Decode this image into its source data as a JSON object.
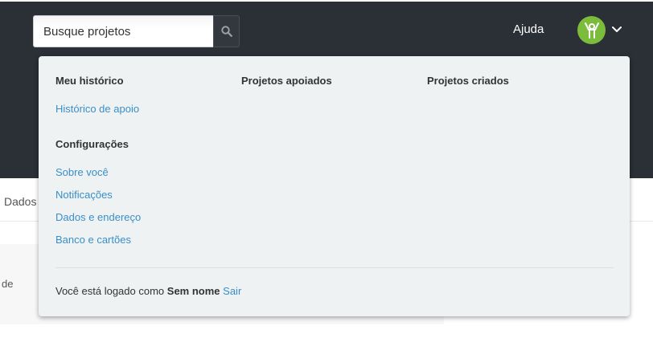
{
  "header": {
    "search": {
      "placeholder": "Busque projetos",
      "value": ""
    },
    "help_label": "Ajuda"
  },
  "dropdown": {
    "columns": [
      "Meu histórico",
      "Projetos apoiados",
      "Projetos criados"
    ],
    "history_links": [
      "Histórico de apoio"
    ],
    "settings_title": "Configurações",
    "settings_links": [
      "Sobre você",
      "Notificações",
      "Dados e endereço",
      "Banco e cartões"
    ],
    "footer": {
      "prefix": "Você está logado como",
      "user_name": "Sem nome",
      "logout_label": "Sair"
    }
  },
  "background": {
    "tab_partial": "Dados",
    "card_text_partial": "de"
  },
  "colors": {
    "header_bg": "#2b2f36",
    "dropdown_bg": "#eef2f3",
    "link": "#3a8ec7",
    "avatar_bg": "#7cbc3c"
  },
  "icons": [
    "search-icon",
    "user-avatar-icon",
    "chevron-down-icon"
  ]
}
